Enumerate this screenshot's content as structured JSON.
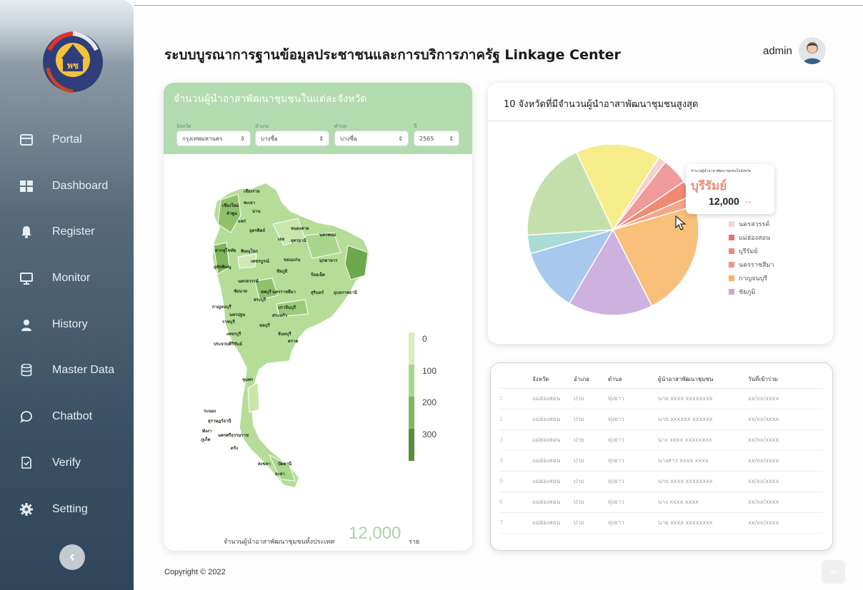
{
  "sidebar": {
    "items": [
      {
        "label": "Portal",
        "icon": "window-icon"
      },
      {
        "label": "Dashboard",
        "icon": "grid-icon"
      },
      {
        "label": "Register",
        "icon": "bell-icon"
      },
      {
        "label": "Monitor",
        "icon": "monitor-icon"
      },
      {
        "label": "History",
        "icon": "user-icon"
      },
      {
        "label": "Master Data",
        "icon": "database-icon"
      },
      {
        "label": "Chatbot",
        "icon": "chat-bubble-icon"
      },
      {
        "label": "Verify",
        "icon": "shield-check-icon"
      },
      {
        "label": "Setting",
        "icon": "gear-icon"
      }
    ]
  },
  "header": {
    "title": "ระบบบูรณาการฐานข้อมูลประชาชนและการบริการภาครัฐ  Linkage Center",
    "user": "admin"
  },
  "map_card": {
    "title": "จำนวนผู้นำอาสาพัฒนาชุมชนในแต่ละจังหวัด",
    "filters": [
      {
        "label": "จังหวัด",
        "value": "กรุงเทพมหานคร"
      },
      {
        "label": "อำเภอ",
        "value": "บางซื่อ"
      },
      {
        "label": "ตำบล",
        "value": "บางซื่อ"
      },
      {
        "label": "ปี",
        "value": "2565"
      }
    ],
    "legend": [
      "0",
      "100",
      "200",
      "300"
    ],
    "legend_colors": [
      "#d4efc0",
      "#a8d68c",
      "#7fb65e",
      "#5a8d3c"
    ],
    "total_label": "จำนวนผู้นำอาสาพัฒนาชุมชนทั้งประเทศ",
    "total_value": "12,000",
    "total_unit": "ราย"
  },
  "pie_card": {
    "title": "10 จังหวัดที่มีจำนวนผู้นำอาสาพัฒนาชุมชนสูงสุด",
    "tooltip": {
      "heading": "จำนวนผู้นำอาสาพัฒนาชุมชนในจังหวัด",
      "province": "บุรีรัมย์",
      "value": "12,000",
      "unit": "ราย"
    },
    "legend": [
      {
        "label": "นครสวรรค์",
        "color": "#f7d2cf"
      },
      {
        "label": "แม่ฮ่องสอน",
        "color": "#e57373"
      },
      {
        "label": "บุรีรัมย์",
        "color": "#f28a72"
      },
      {
        "label": "นครราชสีมา",
        "color": "#e39a8a"
      },
      {
        "label": "กาญจนบุรี",
        "color": "#f8b26a"
      },
      {
        "label": "ชัยภูมิ",
        "color": "#c9a8dc"
      }
    ]
  },
  "chart_data": {
    "type": "pie",
    "slices": [
      {
        "label": "",
        "value": 16,
        "color": "#f6ec8a"
      },
      {
        "label": "นครสวรรค์",
        "value": 1.5,
        "color": "#f7d2cf"
      },
      {
        "label": "แม่ฮ่องสอน",
        "value": 5,
        "color": "#f09a9a"
      },
      {
        "label": "บุรีรัมย์",
        "value": 3,
        "color": "#f28a72"
      },
      {
        "label": "นครราชสีมา",
        "value": 2,
        "color": "#f4a58a"
      },
      {
        "label": "กาญจนบุรี",
        "value": 22,
        "color": "#f8c07a"
      },
      {
        "label": "ชัยภูมิ",
        "value": 16,
        "color": "#cdb1df"
      },
      {
        "label": "",
        "value": 12,
        "color": "#a9c8ee"
      },
      {
        "label": "",
        "value": 3.5,
        "color": "#a9dcd5"
      },
      {
        "label": "",
        "value": 19,
        "color": "#c5dfac"
      }
    ]
  },
  "table": {
    "headers": [
      "",
      "จังหวัด",
      "อำเภอ",
      "ตำบล",
      "ผู้นำอาสาพัฒนาชุมชน",
      "วันที่เข้าร่วม"
    ],
    "rows": [
      [
        "1",
        "แม่ฮ่องสอน",
        "ปาย",
        "ทุ่งยาว",
        "นาย xxxx xxxxxxxx",
        "xx/xx/xxxx"
      ],
      [
        "2",
        "แม่ฮ่องสอน",
        "ปาย",
        "ทุ่งยาว",
        "นาย xxxxxx xxxxxx",
        "xx/xx/xxxx"
      ],
      [
        "3",
        "แม่ฮ่องสอน",
        "ปาย",
        "ทุ่งยาว",
        "นาง xxxx xxxxxxxx",
        "xx/xx/xxxx"
      ],
      [
        "4",
        "แม่ฮ่องสอน",
        "ปาย",
        "ทุ่งยาว",
        "นางสาว xxxx xxxx",
        "xx/xx/xxxx"
      ],
      [
        "5",
        "แม่ฮ่องสอน",
        "ปาย",
        "ทุ่งยาว",
        "นาย xxxx xxxxxxxx",
        "xx/xx/xxxx"
      ],
      [
        "6",
        "แม่ฮ่องสอน",
        "ปาย",
        "ทุ่งยาว",
        "นาง xxxx xxxx",
        "xx/xx/xxxx"
      ],
      [
        "7",
        "แม่ฮ่องสอน",
        "ปาย",
        "ทุ่งยาว",
        "นาย xxxx xxxxxxxx",
        "xx/xx/xxxx"
      ]
    ]
  },
  "footer": {
    "copyright": "Copyright © 2022"
  }
}
